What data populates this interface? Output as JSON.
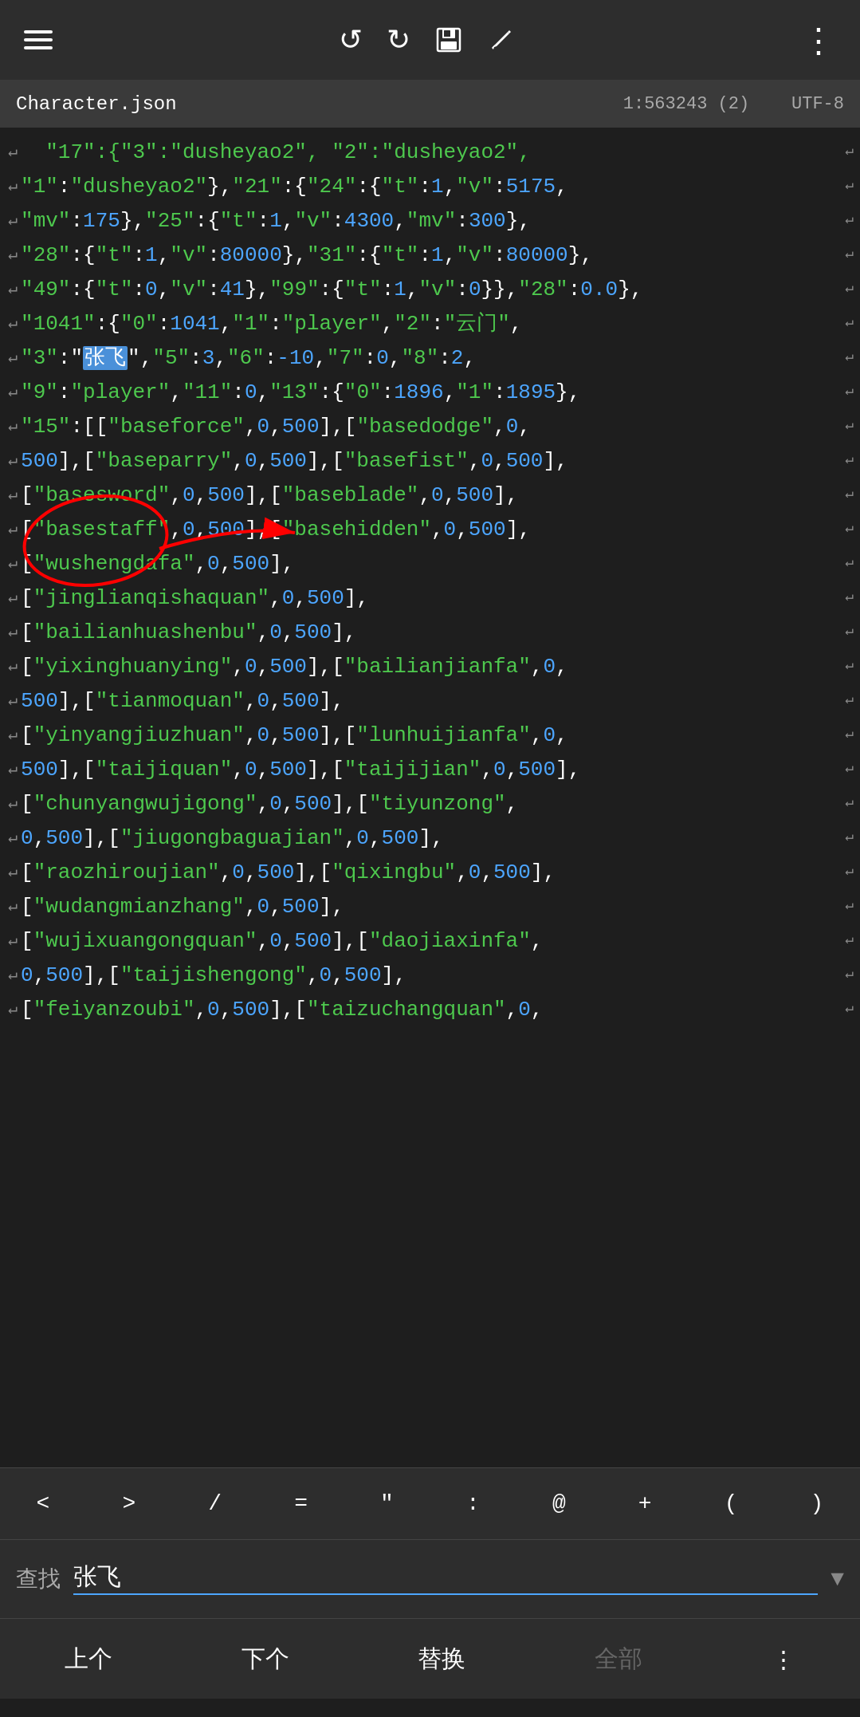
{
  "toolbar": {
    "menu_label": "☰",
    "undo_label": "↺",
    "redo_label": "↻",
    "save_label": "💾",
    "edit_label": "✏",
    "more_label": "⋮"
  },
  "file_bar": {
    "filename": "Character.json",
    "position": "1:563243 (2)",
    "encoding": "UTF-8"
  },
  "code_lines": [
    {
      "indent": true,
      "content": "\"17\":{\"3\":\"dusheyao2\", \"2\":\"dusheyao2\",",
      "has_wrap": true
    },
    {
      "indent": true,
      "content": "\"1\":\"dusheyao2\"},\"21\":{\"24\":{\"t\":1,\"v\":5175,",
      "has_wrap": true
    },
    {
      "indent": true,
      "content": "\"mv\":175},\"25\":{\"t\":1,\"v\":4300,\"mv\":300},",
      "has_wrap": true
    },
    {
      "indent": true,
      "content": "\"28\":{\"t\":1,\"v\":80000},\"31\":{\"t\":1,\"v\":80000},",
      "has_wrap": true
    },
    {
      "indent": true,
      "content": "\"49\":{\"t\":0,\"v\":41},\"99\":{\"t\":1,\"v\":0}},\"28\":0.0},",
      "has_wrap": true
    },
    {
      "indent": true,
      "content": "\"1041\":{\"0\":1041,\"1\":\"player\",\"2\":\"云门\",",
      "has_wrap": true
    },
    {
      "indent": true,
      "content": "\"3\":\"张飞\",\"5\":3,\"6\":-10,\"7\":0,\"8\":2,",
      "has_wrap": true,
      "highlight": "张飞"
    },
    {
      "indent": true,
      "content": "\"9\":\"player\",\"11\":0,\"13\":{\"0\":1896,\"1\":1895},",
      "has_wrap": true
    },
    {
      "indent": true,
      "content": "\"15\":[[\"baseforce\",0,500],[\"basedodge\",0,",
      "has_wrap": true
    },
    {
      "indent": true,
      "content": "500],[\"baseparry\",0,500],[\"basefist\",0,500],",
      "has_wrap": true
    },
    {
      "indent": true,
      "content": "[\"basesword\",0,500],[\"baseblade\",0,500],",
      "has_wrap": true
    },
    {
      "indent": true,
      "content": "[\"basestaff\",0,500],[\"basehidden\",0,500],",
      "has_wrap": true
    },
    {
      "indent": true,
      "content": "[\"wushengdafa\",0,500],",
      "has_wrap": true
    },
    {
      "indent": true,
      "content": "[\"jinglianqishaquan\",0,500],",
      "has_wrap": true
    },
    {
      "indent": true,
      "content": "[\"bailianhuashenbu\",0,500],",
      "has_wrap": true
    },
    {
      "indent": true,
      "content": "[\"yixinghuanying\",0,500],[\"bailianjianfa\",0,",
      "has_wrap": true
    },
    {
      "indent": true,
      "content": "500],[\"tianmoquan\",0,500],",
      "has_wrap": true
    },
    {
      "indent": true,
      "content": "[\"yinyangjiuzhuan\",0,500],[\"lunhuijianfa\",0,",
      "has_wrap": true
    },
    {
      "indent": true,
      "content": "500],[\"taijiquan\",0,500],[\"taijijian\",0,500],",
      "has_wrap": true
    },
    {
      "indent": true,
      "content": "[\"chunyangwujigong\",0,500],[\"tiyunzong\",",
      "has_wrap": true
    },
    {
      "indent": true,
      "content": "0,500],[\"jiugongbaguajian\",0,500],",
      "has_wrap": true
    },
    {
      "indent": true,
      "content": "[\"raozhiroujian\",0,500],[\"qixingbu\",0,500],",
      "has_wrap": true
    },
    {
      "indent": true,
      "content": "[\"wudangmianzhang\",0,500],",
      "has_wrap": true
    },
    {
      "indent": true,
      "content": "[\"wujixuangongquan\",0,500],[\"daojiaxinfa\",",
      "has_wrap": true
    },
    {
      "indent": true,
      "content": "0,500],[\"taijishengong\",0,500],",
      "has_wrap": true
    },
    {
      "indent": true,
      "content": "[\"feiyanzoubi\",0,500],[\"taizuchangquan\",0,",
      "has_wrap": true
    }
  ],
  "symbol_bar": {
    "symbols": [
      "<",
      ">",
      "/",
      "=",
      "\"",
      ":",
      "@",
      "+",
      "(",
      ")"
    ]
  },
  "search_bar": {
    "label": "查找",
    "value": "张飞",
    "placeholder": ""
  },
  "action_bar": {
    "prev_label": "上个",
    "next_label": "下个",
    "replace_label": "替换",
    "all_label": "全部",
    "more_label": "⋮"
  }
}
